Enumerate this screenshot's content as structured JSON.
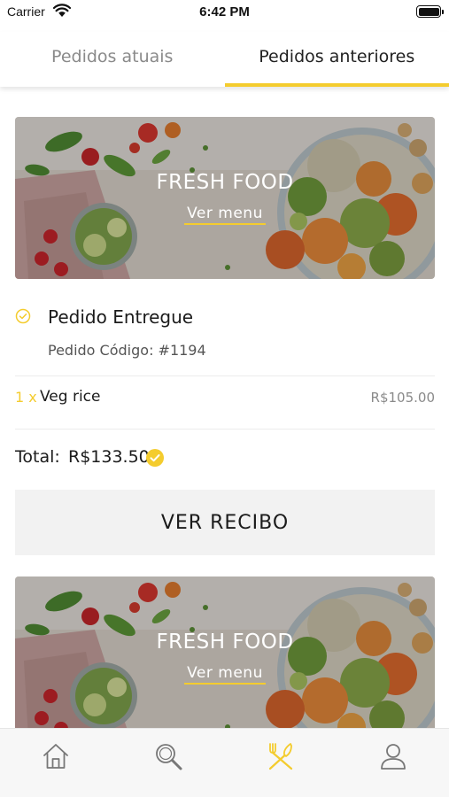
{
  "status_bar": {
    "carrier": "Carrier",
    "time": "6:42 PM",
    "icons": [
      "wifi-icon",
      "battery-icon"
    ]
  },
  "tabs": [
    {
      "label": "Pedidos atuais",
      "active": false
    },
    {
      "label": "Pedidos anteriores",
      "active": true
    }
  ],
  "orders": [
    {
      "banner_title": "FRESH FOOD",
      "banner_link": "Ver menu",
      "status": "Pedido Entregue",
      "code": "Pedido Código: #1194",
      "items": [
        {
          "qty": "1 x",
          "name": "Veg rice",
          "price": "R$105.00"
        }
      ],
      "total_label": "Total:",
      "total_value": "R$133.50",
      "receipt_button": "VER RECIBO"
    },
    {
      "banner_title": "FRESH FOOD",
      "banner_link": "Ver menu"
    }
  ],
  "bottom_nav": [
    {
      "icon": "home-icon",
      "active": false
    },
    {
      "icon": "search-icon",
      "active": false
    },
    {
      "icon": "utensils-icon",
      "active": true
    },
    {
      "icon": "user-icon",
      "active": false
    }
  ],
  "colors": {
    "accent": "#f4cc2e",
    "inactive_tab": "#8a8a8a",
    "button_bg": "#f2f2f2",
    "nav_bg": "#f7f7f7"
  }
}
